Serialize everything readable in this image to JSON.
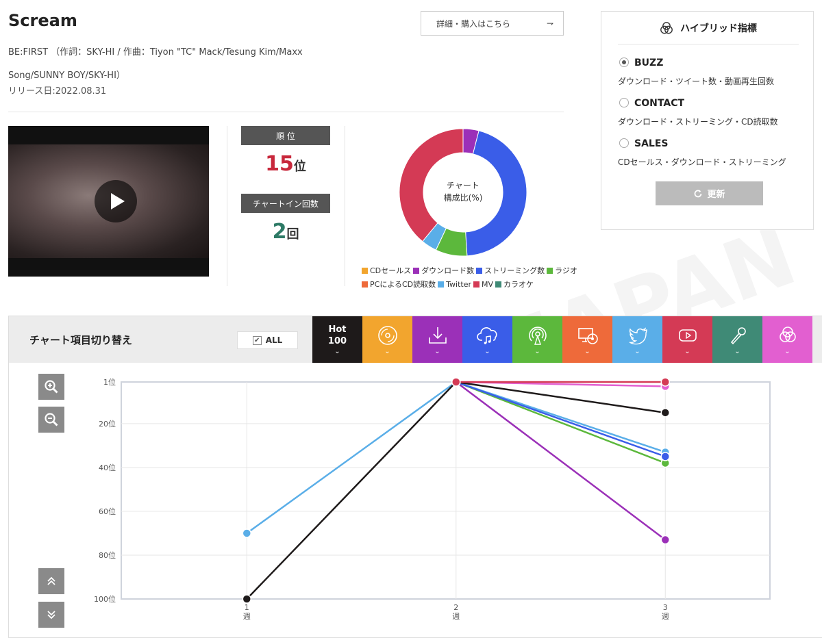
{
  "song": {
    "title": "Scream",
    "credit": "BE:FIRST （作詞：SKY-HI / 作曲：Tiyon \"TC\" Mack/Tesung Kim/Maxx Song/SUNNY BOY/SKY-HI）",
    "release": "リリース日:2022.08.31",
    "buy_label": "詳細・購入はこちら",
    "buy_arrow": "⇁"
  },
  "stats": {
    "rank_label": "順 位",
    "rank_value": "15",
    "rank_unit": "位",
    "rank_color": "#c8283c",
    "chartin_label": "チャートイン回数",
    "chartin_value": "2",
    "chartin_unit": "回",
    "chartin_color": "#2e7a66"
  },
  "donut": {
    "center_line1": "チャート",
    "center_line2": "構成比(%)",
    "segments": [
      {
        "name": "ダウンロード数",
        "value": 4,
        "color": "#9b30b8"
      },
      {
        "name": "ストリーミング数",
        "value": 45,
        "color": "#3a5de8"
      },
      {
        "name": "ラジオ",
        "value": 8,
        "color": "#5cb83c"
      },
      {
        "name": "Twitter",
        "value": 4,
        "color": "#5aaee8"
      },
      {
        "name": "MV",
        "value": 39,
        "color": "#d43a55"
      }
    ],
    "legend": [
      {
        "label": "CDセールス",
        "color": "#f2a52e"
      },
      {
        "label": "ダウンロード数",
        "color": "#9b30b8"
      },
      {
        "label": "ストリーミング数",
        "color": "#3a5de8"
      },
      {
        "label": "ラジオ",
        "color": "#5cb83c"
      },
      {
        "label": "PCによるCD読取数",
        "color": "#ee6a3a"
      },
      {
        "label": "Twitter",
        "color": "#5aaee8"
      },
      {
        "label": "MV",
        "color": "#d43a55"
      },
      {
        "label": "カラオケ",
        "color": "#3f8a76"
      }
    ]
  },
  "hybrid": {
    "title": "ハイブリッド指標",
    "options": [
      {
        "name": "BUZZ",
        "desc": "ダウンロード・ツイート数・動画再生回数",
        "selected": true
      },
      {
        "name": "CONTACT",
        "desc": "ダウンロード・ストリーミング・CD読取数",
        "selected": false
      },
      {
        "name": "SALES",
        "desc": "CDセールス・ダウンロード・ストリーミング",
        "selected": false
      }
    ],
    "refresh_label": "更新"
  },
  "switcher": {
    "title": "チャート項目切り替え",
    "all_label": "ALL",
    "hot_line1": "Hot",
    "hot_line2": "100",
    "tabs": [
      {
        "icon": "hot100",
        "color": "#1e1a1a"
      },
      {
        "icon": "cd-icon",
        "color": "#f2a52e"
      },
      {
        "icon": "download-icon",
        "color": "#9b30b8"
      },
      {
        "icon": "streaming-icon",
        "color": "#3a5de8"
      },
      {
        "icon": "radio-icon",
        "color": "#5cb83c"
      },
      {
        "icon": "pc-cd-icon",
        "color": "#ee6a3a"
      },
      {
        "icon": "twitter-icon",
        "color": "#5aaee8"
      },
      {
        "icon": "youtube-icon",
        "color": "#d43a55"
      },
      {
        "icon": "karaoke-icon",
        "color": "#3f8a76"
      },
      {
        "icon": "hybrid-icon",
        "color": "#e25fd0"
      }
    ]
  },
  "chart_data": {
    "type": "line",
    "x": [
      1,
      2,
      3
    ],
    "x_tick_labels": [
      "1\n週",
      "2\n週",
      "3\n週"
    ],
    "y_ticks": [
      1,
      20,
      40,
      60,
      80,
      100
    ],
    "y_tick_labels": [
      "1位",
      "20位",
      "40位",
      "60位",
      "80位",
      "100位"
    ],
    "ylim": [
      1,
      100
    ],
    "y_reversed": true,
    "grid": true,
    "series": [
      {
        "color": "#e25fd0",
        "values": [
          null,
          1,
          3
        ]
      },
      {
        "color": "#9b30b8",
        "values": [
          null,
          1,
          73
        ]
      },
      {
        "color": "#5cb83c",
        "values": [
          null,
          1,
          38
        ]
      },
      {
        "color": "#5aaee8",
        "values": [
          70,
          1,
          33
        ]
      },
      {
        "color": "#3a5de8",
        "values": [
          null,
          1,
          35
        ]
      },
      {
        "color": "#1e1a1a",
        "values": [
          100,
          1,
          15
        ]
      },
      {
        "color": "#d43a55",
        "values": [
          null,
          1,
          1
        ]
      }
    ]
  }
}
